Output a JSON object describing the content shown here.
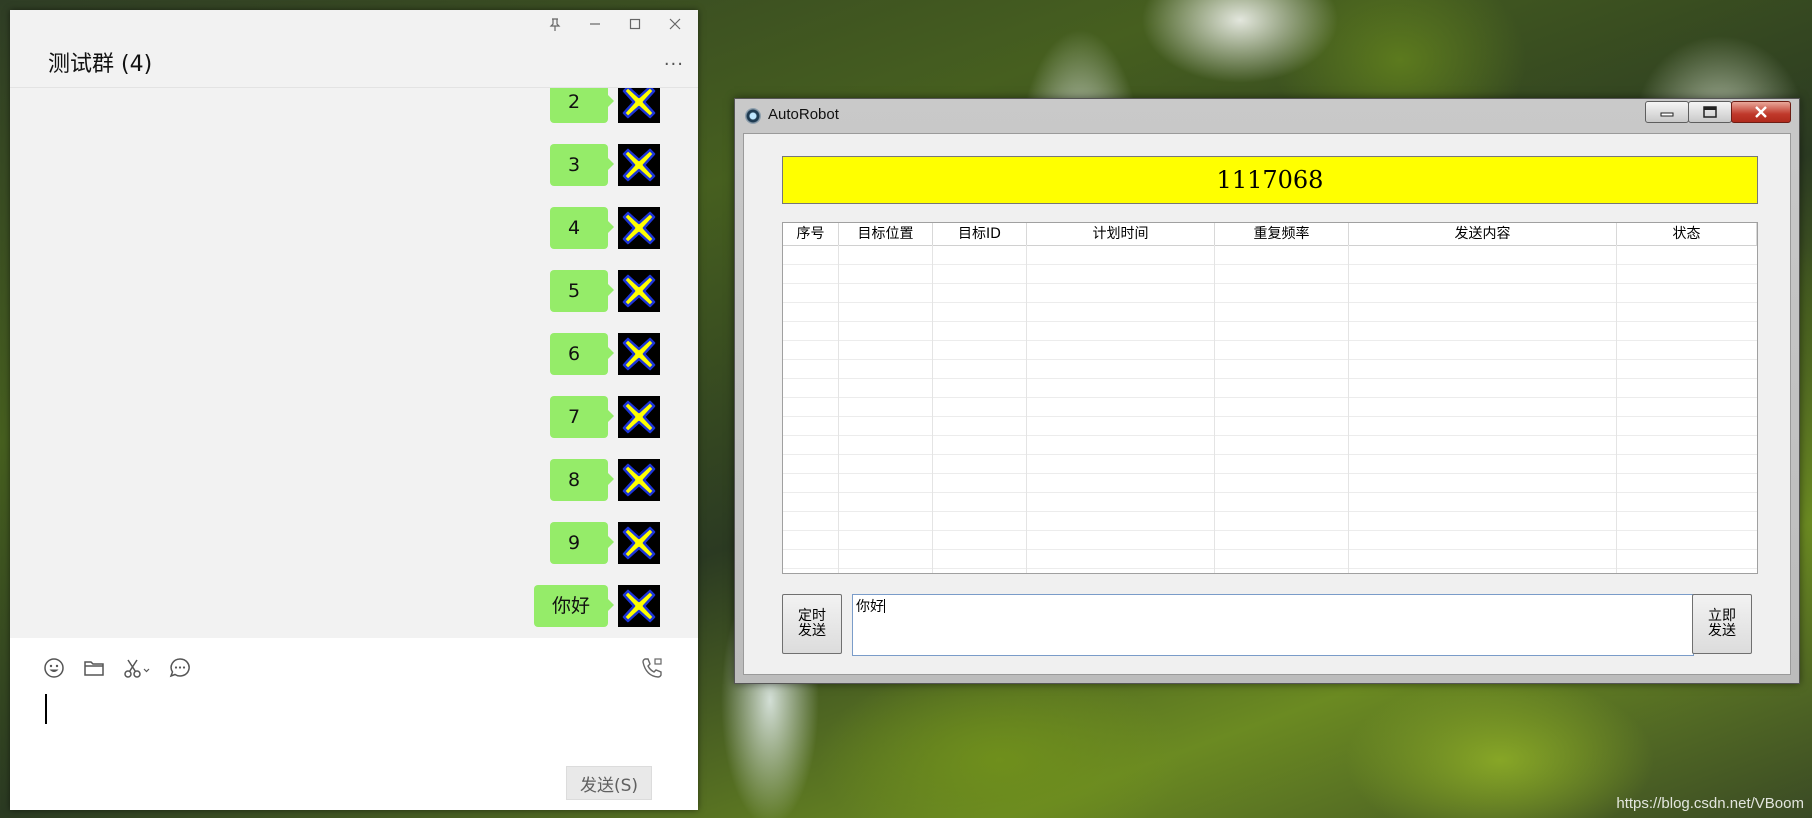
{
  "chat": {
    "title": "测试群 (4)",
    "more": "···",
    "controls": [
      "pin-icon",
      "minimize-icon",
      "maximize-icon",
      "close-icon"
    ],
    "messages": [
      {
        "text": "2"
      },
      {
        "text": "3"
      },
      {
        "text": "4"
      },
      {
        "text": "5"
      },
      {
        "text": "6"
      },
      {
        "text": "7"
      },
      {
        "text": "8"
      },
      {
        "text": "9"
      },
      {
        "text": "你好"
      }
    ],
    "toolbar": [
      "emoji-icon",
      "folder-icon",
      "scissors-icon",
      "chat-history-icon"
    ],
    "call_icon": "video-call-icon",
    "send_label": "发送(S)"
  },
  "robot": {
    "title": "AutoRobot",
    "counter": "1117068",
    "table": {
      "columns": [
        "序号",
        "目标位置",
        "目标ID",
        "计划时间",
        "重复频率",
        "发送内容",
        "状态"
      ],
      "rows": []
    },
    "timed_send_label": "定时\n发送",
    "send_now_label": "立即\n发送",
    "input_value": "你好"
  },
  "watermark": "https://blog.csdn.net/VBoom",
  "colors": {
    "bubble": "#95ec69",
    "counter_bg": "#ffff00",
    "avatar_x": "#ffff00",
    "avatar_x_outline": "#1d35d8"
  }
}
